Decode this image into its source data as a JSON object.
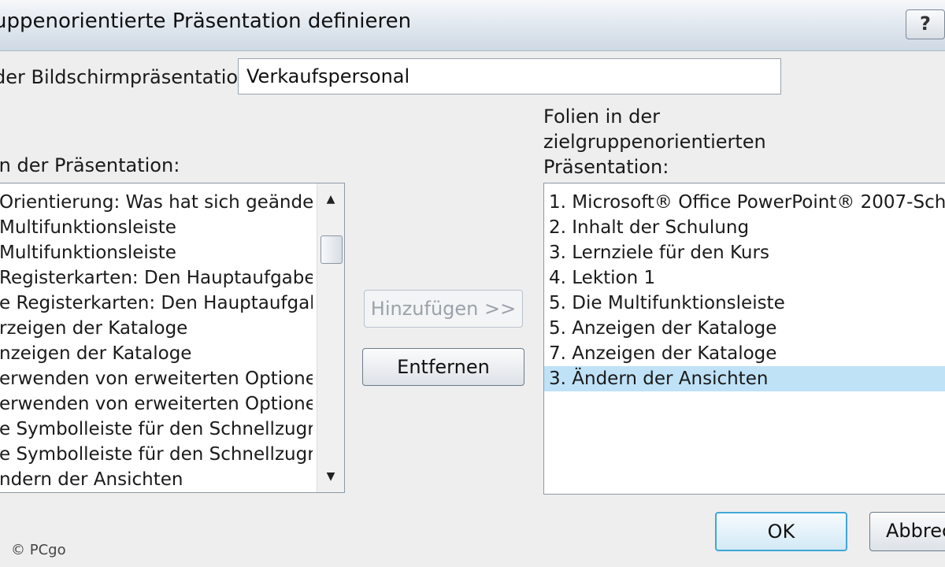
{
  "window": {
    "title": "uppenorientierte Präsentation definieren",
    "help_label": "?"
  },
  "name_field": {
    "label": "der Bildschirmpräsentation:",
    "value": "Verkaufspersonal"
  },
  "left_panel": {
    "label": "in der Präsentation:",
    "items": [
      "Orientierung: Was hat sich geände",
      "Multifunktionsleiste",
      "Multifunktionsleiste",
      "Registerkarten: Den Hauptaufgabe",
      "e Registerkarten: Den Hauptaufgab",
      "rzeigen der Kataloge",
      "nzeigen der Kataloge",
      "erwenden von erweiterten Optionen",
      "erwenden von erweiterten Optionen",
      "e Symbolleiste für den Schnellzugriff",
      "e Symbolleiste für den Schnellzugriff",
      "ndern der Ansichten"
    ]
  },
  "right_panel": {
    "label_lines": [
      "Folien in der",
      "zielgruppenorientierten",
      "Präsentation:"
    ],
    "items": [
      "1. Microsoft® Office  PowerPoint®  2007-Sch",
      "2. Inhalt der Schulung",
      "3. Lernziele für den Kurs",
      "4. Lektion 1",
      "5. Die Multifunktionsleiste",
      "5. Anzeigen der Kataloge",
      "7. Anzeigen der Kataloge",
      "3. Ändern der Ansichten"
    ],
    "selected_index": 7
  },
  "buttons": {
    "add_label": "Hinzufügen >>",
    "remove_label": "Entfernen",
    "ok_label": "OK",
    "cancel_label": "Abbrec"
  },
  "scrollbar": {
    "up_icon": "▲",
    "down_icon": "▼"
  },
  "watermark": "© PCgo",
  "colors": {
    "selection": "#bfe2f7",
    "ok_border": "#3fa7d9"
  }
}
